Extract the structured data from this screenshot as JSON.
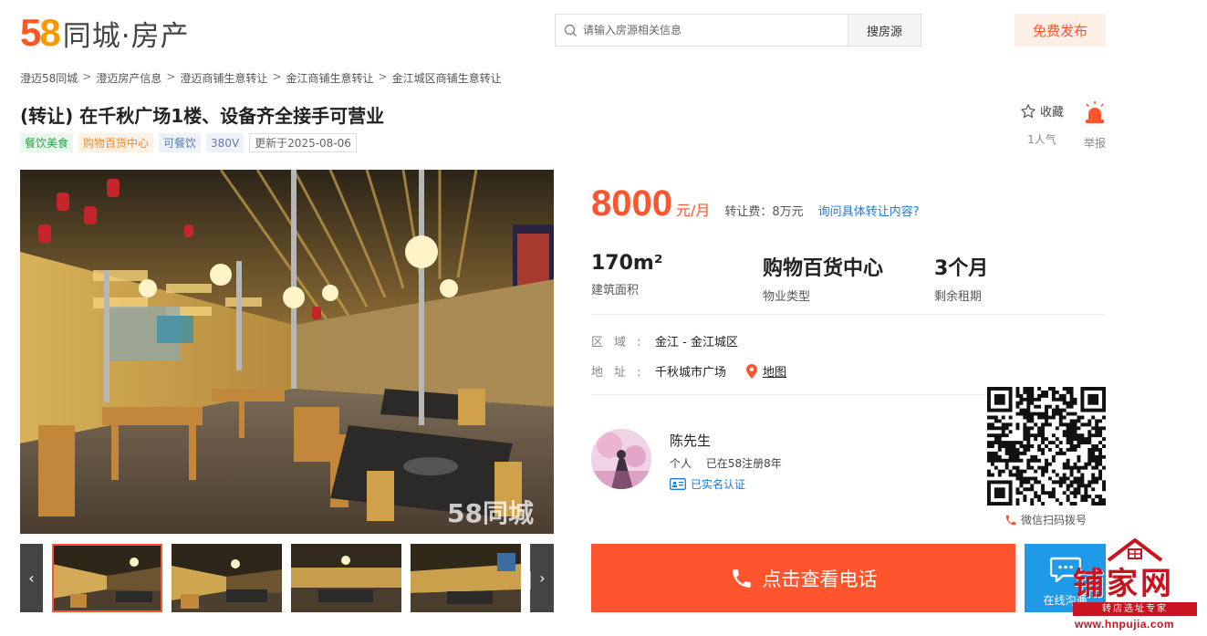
{
  "header": {
    "logo_digit_1": "5",
    "logo_digit_2": "8",
    "logo_text": "同城·房产",
    "search_placeholder": "请输入房源相关信息",
    "search_button": "搜房源",
    "publish_button": "免费发布"
  },
  "breadcrumb": [
    "澄迈58同城",
    "澄迈房产信息",
    "澄迈商铺生意转让",
    "金江商铺生意转让",
    "金江城区商铺生意转让"
  ],
  "breadcrumb_sep": ">",
  "listing": {
    "title": "(转让) 在千秋广场1楼、设备齐全接手可营业",
    "tags": [
      "餐饮美食",
      "购物百货中心",
      "可餐饮",
      "380V"
    ],
    "updated": "更新于2025-08-06",
    "favorite_label": "收藏",
    "popularity": "1人气",
    "report_label": "举报"
  },
  "gallery": {
    "watermark": "58同城",
    "prev": "‹",
    "next": "›",
    "thumbnail_count": 5
  },
  "price": {
    "amount": "8000",
    "unit": "元/月",
    "transfer_fee": "转让费：8万元",
    "ask_link": "询问具体转让内容?"
  },
  "stats": [
    {
      "value": "170m²",
      "label": "建筑面积"
    },
    {
      "value": "购物百货中心",
      "label": "物业类型"
    },
    {
      "value": "3个月",
      "label": "剩余租期"
    }
  ],
  "location": {
    "area_key": "区域:",
    "area_value": "金江 - 金江城区",
    "address_key": "地址:",
    "address_value": "千秋城市广场",
    "map_link": "地图"
  },
  "agent": {
    "name": "陈先生",
    "type": "个人",
    "registered": "已在58注册8年",
    "verified": "已实名认证"
  },
  "qr_caption": "微信扫码拨号",
  "actions": {
    "call_button": "点击查看电话",
    "chat_button": "在线沟通"
  },
  "watermark_site": {
    "name": "铺家网",
    "slogan": "转店选址专家",
    "url": "www.hnpujia.com"
  },
  "colors": {
    "accent": "#ff552e",
    "link": "#1d7ad9",
    "chat": "#1f9ae8"
  }
}
